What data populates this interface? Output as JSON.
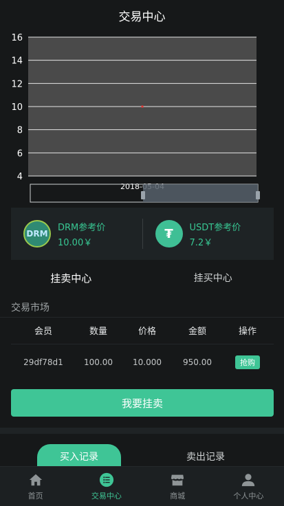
{
  "header": {
    "title": "交易中心"
  },
  "chart_data": {
    "type": "scatter",
    "x": [
      "2018-05-04"
    ],
    "y": [
      10
    ],
    "ylim": [
      4,
      16
    ],
    "yticks": [
      "16",
      "14",
      "12",
      "10",
      "8",
      "6",
      "4"
    ],
    "xticks": [
      "2018-05-04"
    ],
    "grid": true,
    "point_color": "#e53935",
    "plot_background": "#4a4a4a"
  },
  "prices": [
    {
      "icon": "drm-coin-icon",
      "coin_label": "DRM",
      "label": "DRM参考价",
      "value": "10.00￥"
    },
    {
      "icon": "usdt-coin-icon",
      "coin_label": "₮",
      "label": "USDT参考价",
      "value": "7.2￥"
    }
  ],
  "tabs": [
    "挂卖中心",
    "挂买中心"
  ],
  "market": {
    "title": "交易市场",
    "columns": [
      "会员",
      "数量",
      "价格",
      "金额",
      "操作"
    ],
    "rows": [
      {
        "member": "29df78d1",
        "amount": "100.00",
        "price": "10.000",
        "total": "950.00",
        "action": "抢购"
      }
    ]
  },
  "main_button": "我要挂卖",
  "records": {
    "buy": "买入记录",
    "sell": "卖出记录"
  },
  "tabbar": [
    {
      "label": "首页",
      "icon": "home-icon"
    },
    {
      "label": "交易中心",
      "icon": "trade-icon"
    },
    {
      "label": "商城",
      "icon": "shop-icon"
    },
    {
      "label": "个人中心",
      "icon": "user-icon"
    }
  ],
  "colors": {
    "accent": "#3fc596",
    "background": "#161819"
  }
}
